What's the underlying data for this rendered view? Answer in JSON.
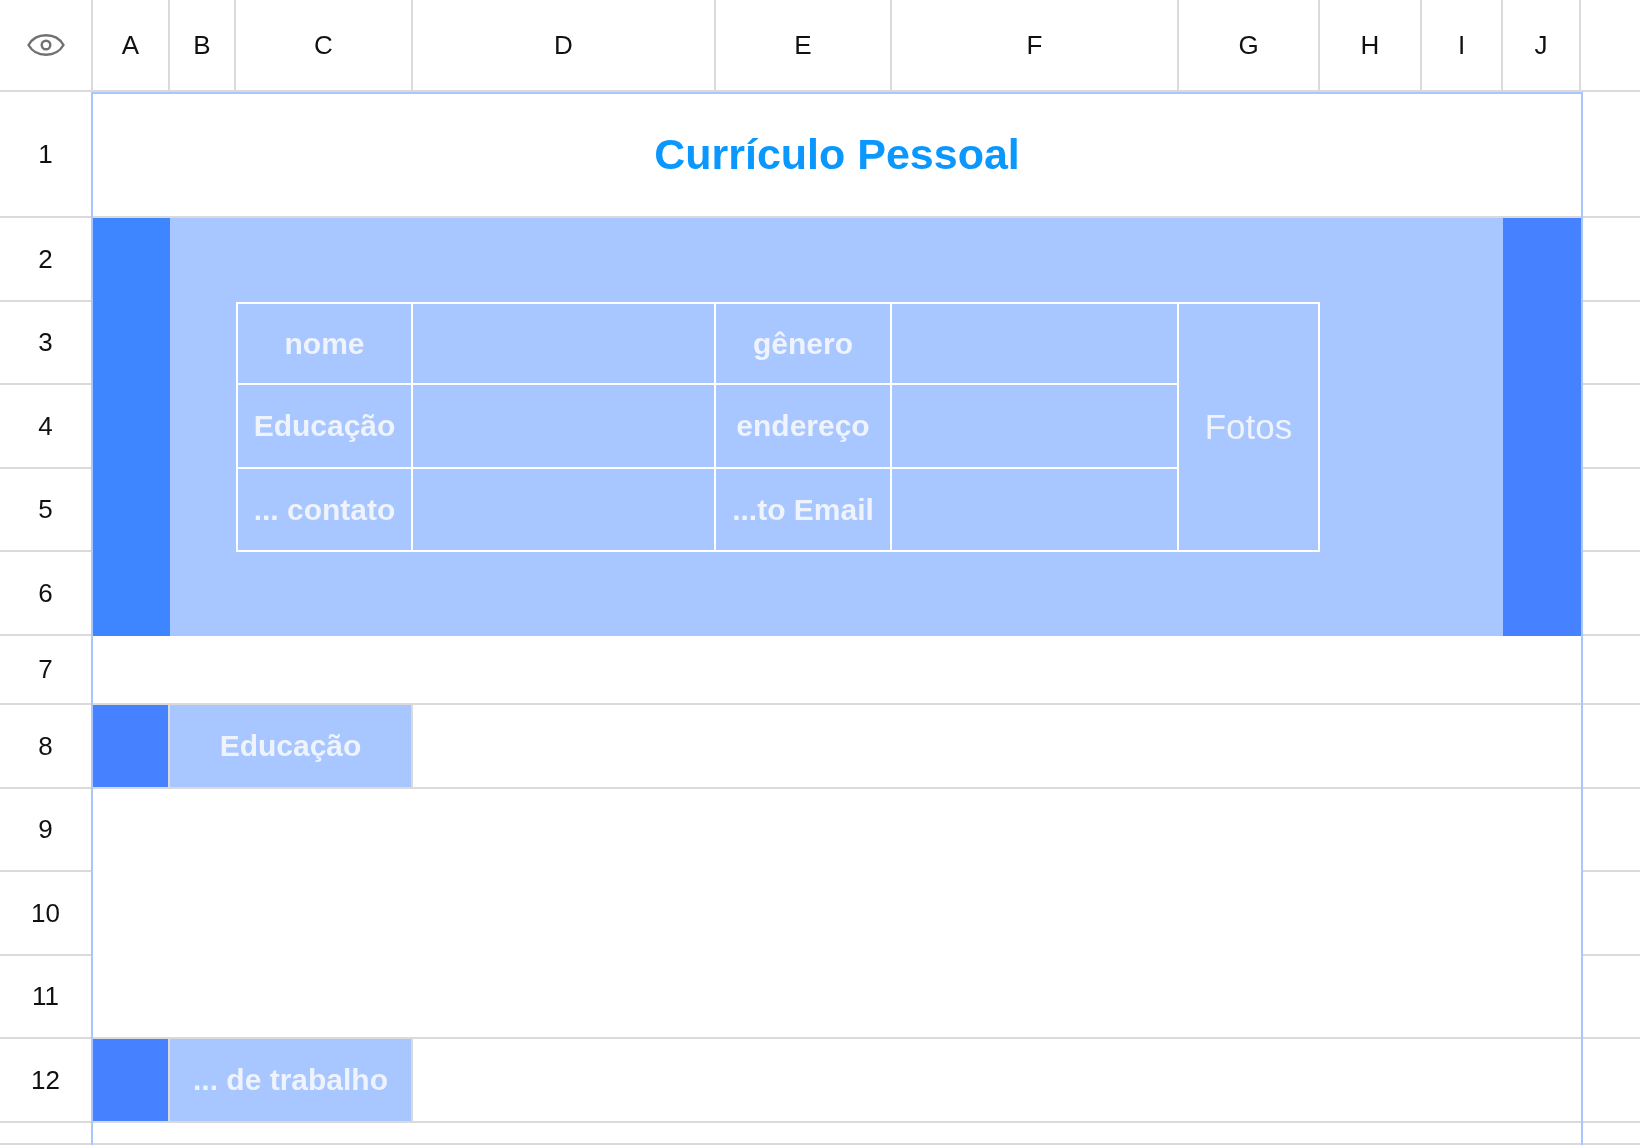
{
  "sheet": {
    "column_headers": [
      "A",
      "B",
      "C",
      "D",
      "E",
      "F",
      "G",
      "H",
      "I",
      "J"
    ],
    "row_headers": [
      "1",
      "2",
      "3",
      "4",
      "5",
      "6",
      "7",
      "8",
      "9",
      "10",
      "11",
      "12"
    ],
    "title": "Currículo Pessoal",
    "info_table": {
      "rows": [
        {
          "labels": [
            "nome",
            "gênero"
          ]
        },
        {
          "labels": [
            "Educação",
            "endereço"
          ]
        },
        {
          "labels": [
            "... contato",
            "...to Email"
          ]
        }
      ],
      "photo_label": "Fotos"
    },
    "sections": [
      {
        "label": "Educação"
      },
      {
        "label": "... de trabalho"
      }
    ]
  }
}
